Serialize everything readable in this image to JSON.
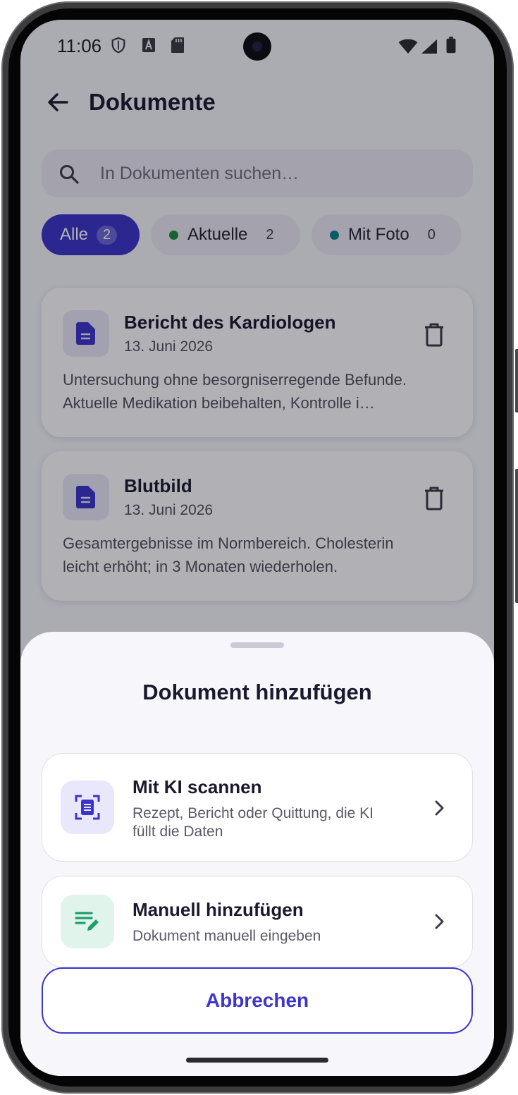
{
  "status_bar": {
    "time": "11:06"
  },
  "header": {
    "title": "Dokumente"
  },
  "search": {
    "placeholder": "In Dokumenten suchen…"
  },
  "filters": [
    {
      "label": "Alle",
      "count": "2",
      "active": true
    },
    {
      "label": "Aktuelle",
      "count": "2",
      "dot_color": "#1e8a3c"
    },
    {
      "label": "Mit Foto",
      "count": "0",
      "dot_color": "#0a7f8c"
    }
  ],
  "documents": [
    {
      "title": "Bericht des Kardiologen",
      "date": "13. Juni 2026",
      "summary_line1": "Untersuchung ohne besorgniserregende Befunde.",
      "summary_line2": "Aktuelle Medikation beibehalten, Kontrolle i…"
    },
    {
      "title": "Blutbild",
      "date": "13. Juni 2026",
      "summary_line1": "Gesamtergebnisse im Normbereich. Cholesterin",
      "summary_line2": "leicht erhöht; in 3 Monaten wiederholen."
    }
  ],
  "sheet": {
    "title": "Dokument hinzufügen",
    "options": [
      {
        "title": "Mit KI scannen",
        "subtitle_line1": "Rezept, Bericht oder Quittung, die KI",
        "subtitle_line2": "füllt die Daten",
        "icon": "scan-document-icon"
      },
      {
        "title": "Manuell hinzufügen",
        "subtitle_line1": "Dokument manuell eingeben",
        "icon": "edit-list-icon"
      }
    ],
    "cancel_label": "Abbrechen"
  },
  "colors": {
    "accent": "#3b34c9",
    "scan_tint": "#e8e7fb",
    "manual_tint": "#e0f4ec",
    "manual_green": "#1f9d6a"
  }
}
